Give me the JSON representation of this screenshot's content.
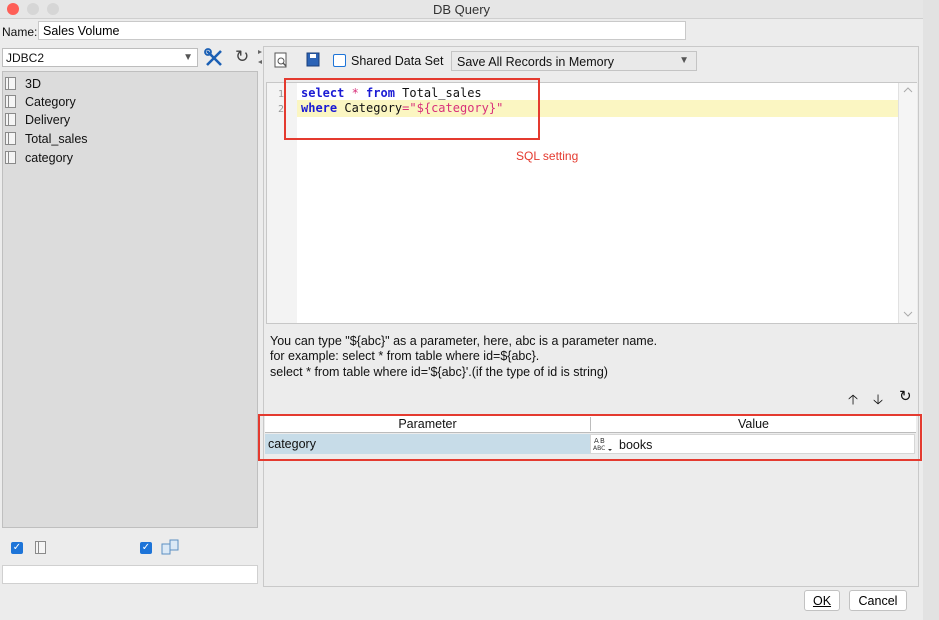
{
  "window": {
    "title": "DB Query"
  },
  "name_field": {
    "label": "Name:",
    "value": "Sales Volume"
  },
  "connection": {
    "selected": "JDBC2"
  },
  "tables": [
    "3D",
    "Category",
    "Delivery",
    "Total_sales",
    "category"
  ],
  "toolbar": {
    "shared_label": "Shared Data Set",
    "shared_checked": false,
    "memory_option": "Save All Records in Memory"
  },
  "editor": {
    "line_numbers": [
      "1",
      "2"
    ],
    "line1": {
      "kw1": "select",
      "op": " * ",
      "kw2": "from",
      "rest": " Total_sales"
    },
    "line2": {
      "kw": "where",
      "field": " Category",
      "eq": "=",
      "str": "\"${category}\""
    }
  },
  "annotation": {
    "sql": "SQL  setting"
  },
  "help": {
    "line1": "You can type \"${abc}\" as a parameter, here, abc is a parameter name.",
    "line2": "for example: select * from table where id=${abc}.",
    "line3": "select * from table where id='${abc}'.(if the type of id is string)"
  },
  "params": {
    "header_param": "Parameter",
    "header_value": "Value",
    "row": {
      "name": "category",
      "value": "books",
      "type_icon": "A-B-C"
    }
  },
  "footer": {
    "ok": "OK",
    "cancel": "Cancel"
  },
  "icons": {
    "connection_tool": "wrench-screwdriver-icon",
    "refresh": "refresh-icon",
    "preview": "preview-document-icon",
    "save": "save-icon",
    "up": "arrow-up-icon",
    "down": "arrow-down-icon"
  }
}
